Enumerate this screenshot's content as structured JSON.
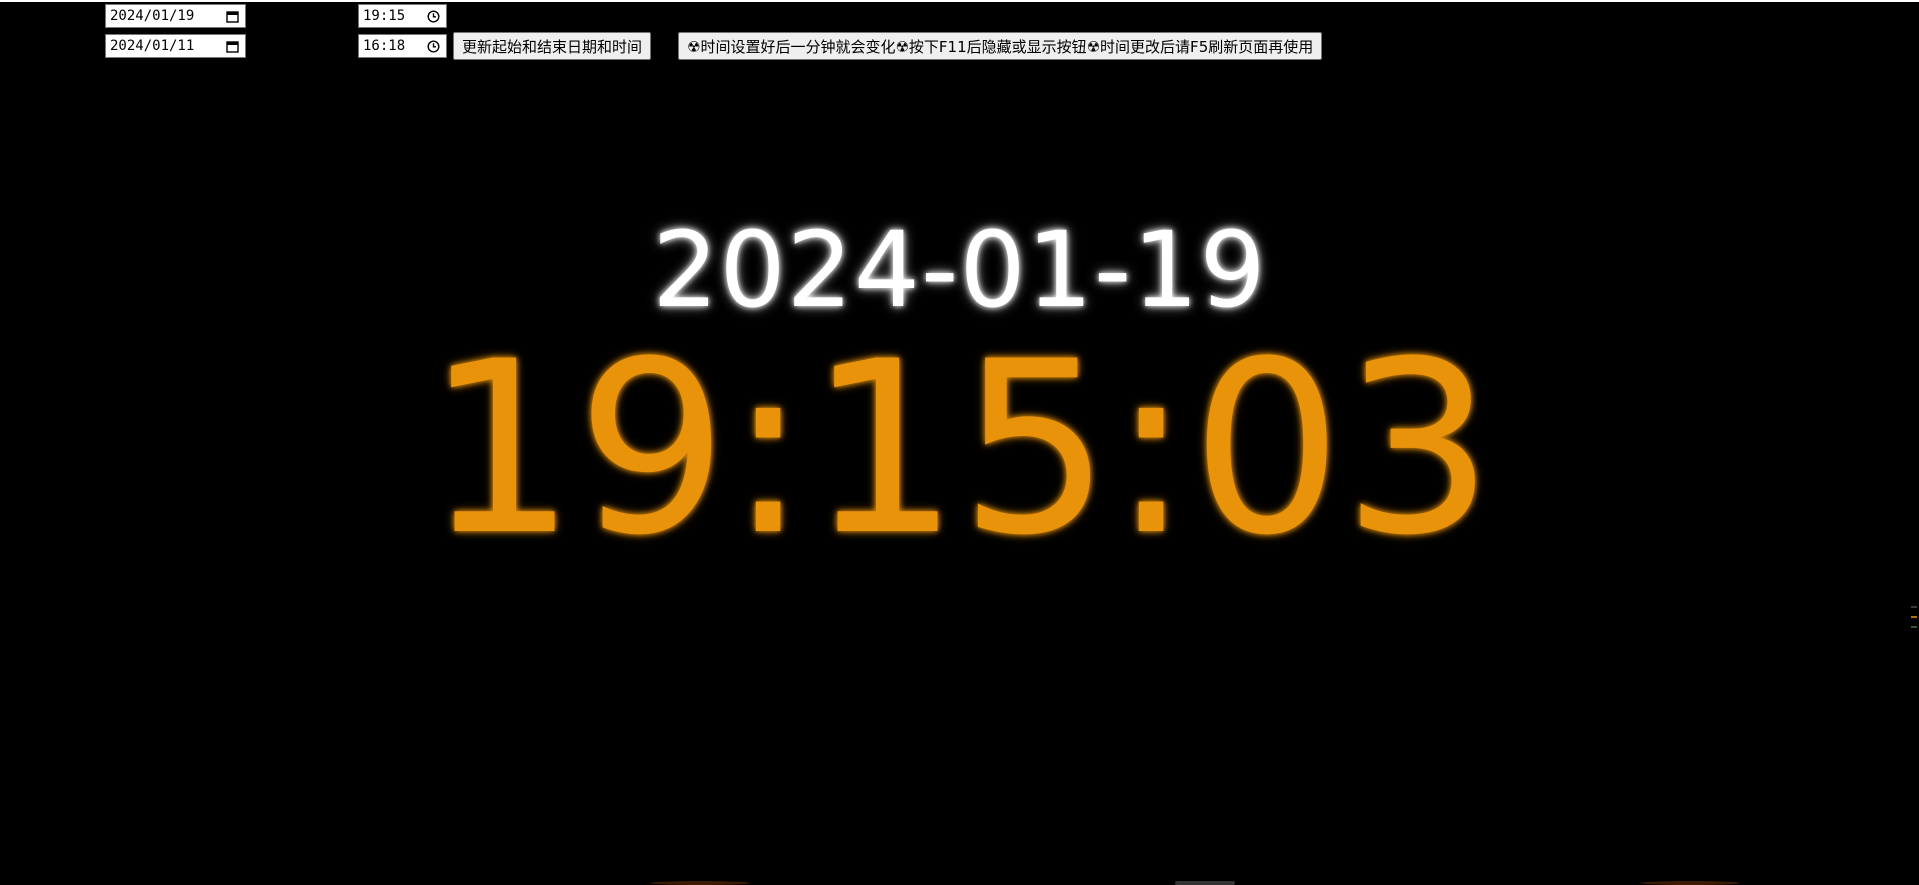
{
  "controls": {
    "start_date": "2024/01/19",
    "end_date": "2024/01/11",
    "start_time": "19:15",
    "end_time": "16:18",
    "update_button_label": "更新起始和结束日期和时间",
    "info_button_label": "☢时间设置好后一分钟就会变化☢按下F11后隐藏或显示按钮☢时间更改后请F5刷新页面再使用"
  },
  "icons": {
    "date_picker": "calendar-icon",
    "time_picker": "clock-icon"
  },
  "display": {
    "date_text": "2024-01-19",
    "time_text": "19:15:03"
  },
  "colors": {
    "background": "#000000",
    "date_color": "#ffffff",
    "time_color": "#e8930a"
  }
}
